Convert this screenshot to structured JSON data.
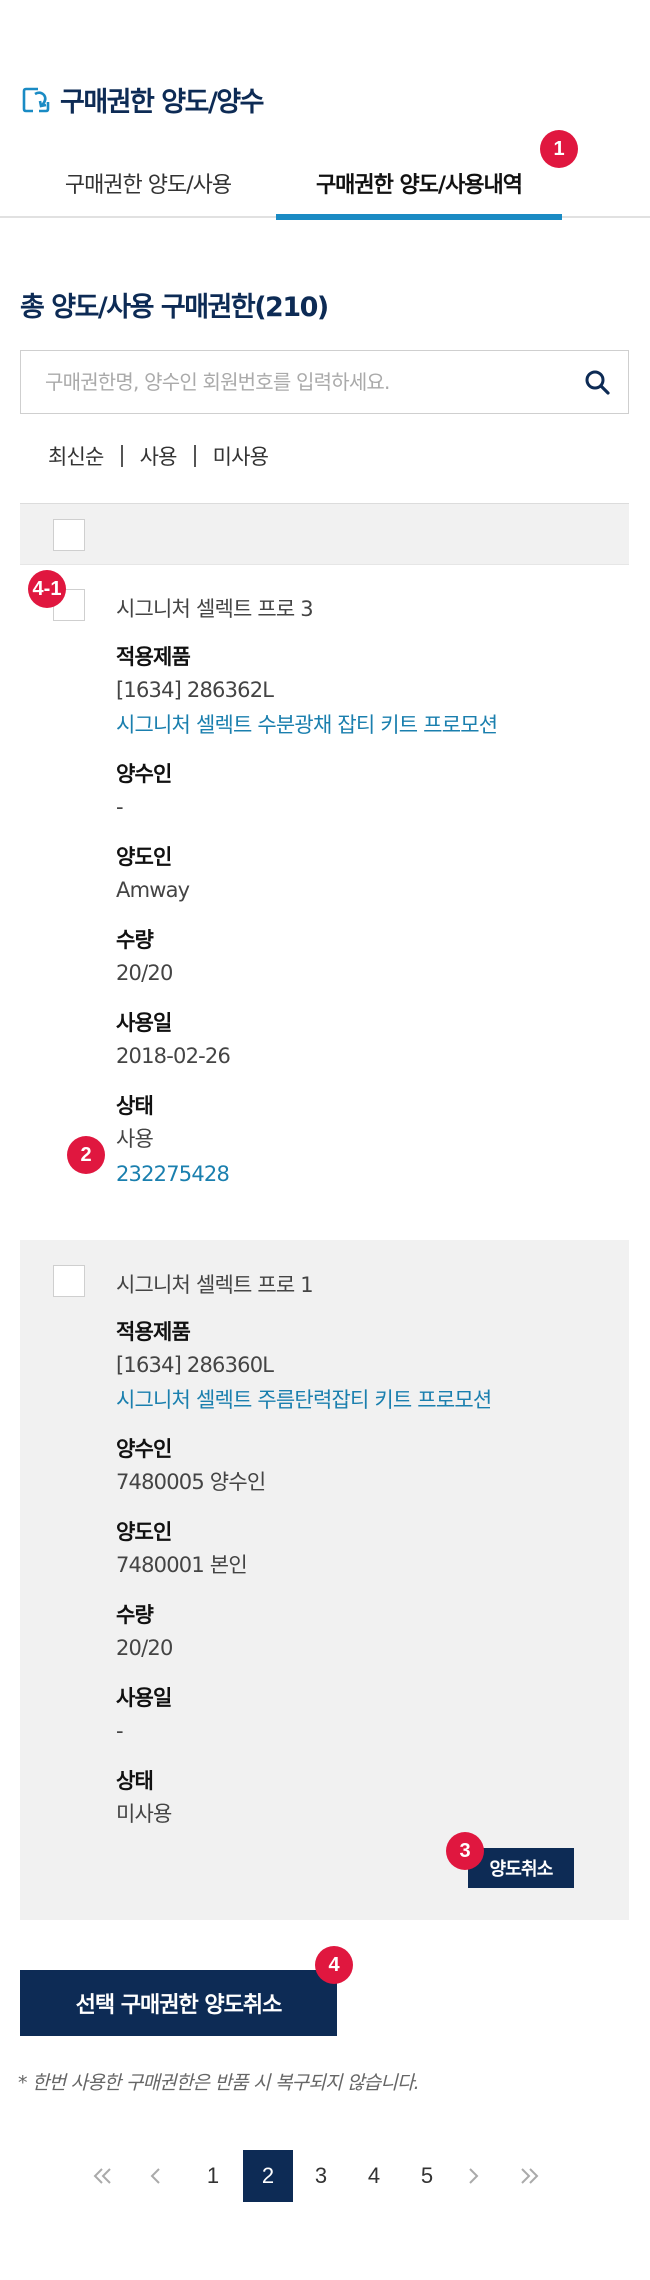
{
  "header": {
    "title": "구매권한 양도/양수",
    "icon": "transfer-icon"
  },
  "tabs": [
    {
      "label": "구매권한 양도/사용"
    },
    {
      "label": "구매권한 양도/사용내역"
    }
  ],
  "badges": {
    "tabs": "1",
    "status": "2",
    "cancel": "3",
    "bulk_cancel": "4",
    "checkbox": "4-1"
  },
  "total_title": "총 양도/사용 구매권한(210)",
  "search": {
    "placeholder": "구매권한명, 양수인 회원번호를 입력하세요.",
    "value": "",
    "icon": "search-icon"
  },
  "sort": [
    "최신순",
    "사용",
    "미사용"
  ],
  "items": [
    {
      "title": "시그니처 셀렉트 프로 3",
      "product_label": "적용제품",
      "product_code": "[1634] 286362L",
      "product_name": "시그니처 셀렉트 수분광채 잡티 키트 프로모션",
      "receiver_label": "양수인",
      "receiver": "-",
      "giver_label": "양도인",
      "giver": "Amway",
      "qty_label": "수량",
      "qty": "20/20",
      "date_label": "사용일",
      "date": "2018-02-26",
      "status_label": "상태",
      "status": "사용",
      "order_no": "232275428"
    },
    {
      "title": "시그니처 셀렉트 프로 1",
      "product_label": "적용제품",
      "product_code": "[1634] 286360L",
      "product_name": "시그니처 셀렉트 주름탄력잡티 키트 프로모션",
      "receiver_label": "양수인",
      "receiver": "7480005 양수인",
      "giver_label": "양도인",
      "giver": "7480001 본인",
      "qty_label": "수량",
      "qty": "20/20",
      "date_label": "사용일",
      "date": "-",
      "status_label": "상태",
      "status": "미사용",
      "cancel_label": "양도취소"
    }
  ],
  "bulk_cancel_label": "선택 구매권한 양도취소",
  "notice": "* 한번 사용한 구매권한은 반품 시 복구되지 않습니다.",
  "pagination": {
    "pages": [
      "1",
      "2",
      "3",
      "4",
      "5"
    ],
    "current": "2"
  },
  "colors": {
    "navy": "#0d2b55",
    "accent_blue": "#1a8bc4",
    "link": "#1a7fae",
    "badge_red": "#e0173f",
    "panel_gray": "#f1f1f1"
  }
}
